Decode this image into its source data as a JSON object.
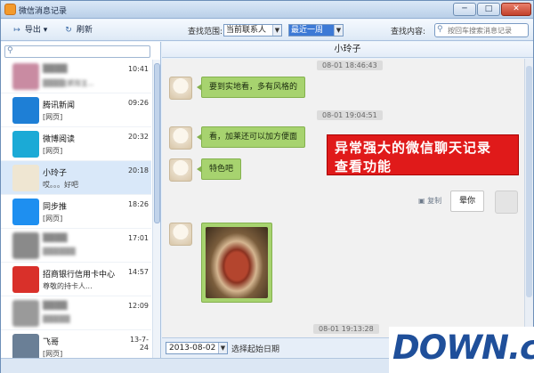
{
  "window": {
    "title": "微信消息记录",
    "min_glyph": "─",
    "max_glyph": "□",
    "close_glyph": "✕"
  },
  "toolbar": {
    "export_label": "导出",
    "export_icon": "↦",
    "refresh_label": "刷新",
    "refresh_icon": "↻",
    "range_label": "查找范围:",
    "range_value": "当前联系人",
    "time_value": "最近一周",
    "content_label": "查找内容:",
    "search_placeholder": "按回车搜索消息记录"
  },
  "sidebar": {
    "contacts": [
      {
        "name": "▒▒▒▒",
        "time": "10:41",
        "preview": "▒▒▒▒[抓狂][...",
        "avatar_color": "#c98ba2",
        "blurred": true,
        "selected": false
      },
      {
        "name": "腾讯新闻",
        "time": "09:26",
        "preview": "[网页]",
        "avatar_color": "#1e7fd6",
        "blurred": false,
        "selected": false
      },
      {
        "name": "微博阅读",
        "time": "20:32",
        "preview": "[网页]",
        "avatar_color": "#1baad6",
        "blurred": false,
        "selected": false
      },
      {
        "name": "小玲子",
        "time": "20:18",
        "preview": "哎。。。好吧",
        "avatar_color": "#efe6d2",
        "blurred": false,
        "selected": true
      },
      {
        "name": "同步推",
        "time": "18:26",
        "preview": "[网页]",
        "avatar_color": "#1e8ff0",
        "blurred": false,
        "selected": false
      },
      {
        "name": "▒▒▒▒",
        "time": "17:01",
        "preview": "▒▒▒▒▒▒",
        "avatar_color": "#8a8a8a",
        "blurred": true,
        "selected": false
      },
      {
        "name": "招商银行信用卡中心",
        "time": "14:57",
        "preview": "尊敬的持卡人...",
        "avatar_color": "#d9302a",
        "blurred": false,
        "selected": false
      },
      {
        "name": "▒▒▒▒",
        "time": "12:09",
        "preview": "▒▒▒▒▒",
        "avatar_color": "#9a9a9a",
        "blurred": true,
        "selected": false
      },
      {
        "name": "飞哥",
        "time": "13-7-24",
        "preview": "[网页]",
        "avatar_color": "#6a7f96",
        "blurred": false,
        "selected": false
      }
    ]
  },
  "chat": {
    "contact_name": "小玲子",
    "messages": [
      {
        "timestamp": "08-01 18:46:43",
        "text": "要到实地看，多有风格的"
      },
      {
        "timestamp": "08-01 19:04:51",
        "text": "看，加莱还可以加方便面"
      },
      {
        "text": "特色吧"
      }
    ],
    "my_message": "晕你",
    "copy_label": "复制",
    "last_timestamp": "08-01 19:13:28"
  },
  "promo": {
    "line1": "异常强大的微信聊天记录",
    "line2": "查看功能"
  },
  "bottom": {
    "date_value": "2013-08-02",
    "date_label": "选择起始日期"
  },
  "watermark": {
    "text": "DOWN",
    "suffix": ".cc"
  }
}
